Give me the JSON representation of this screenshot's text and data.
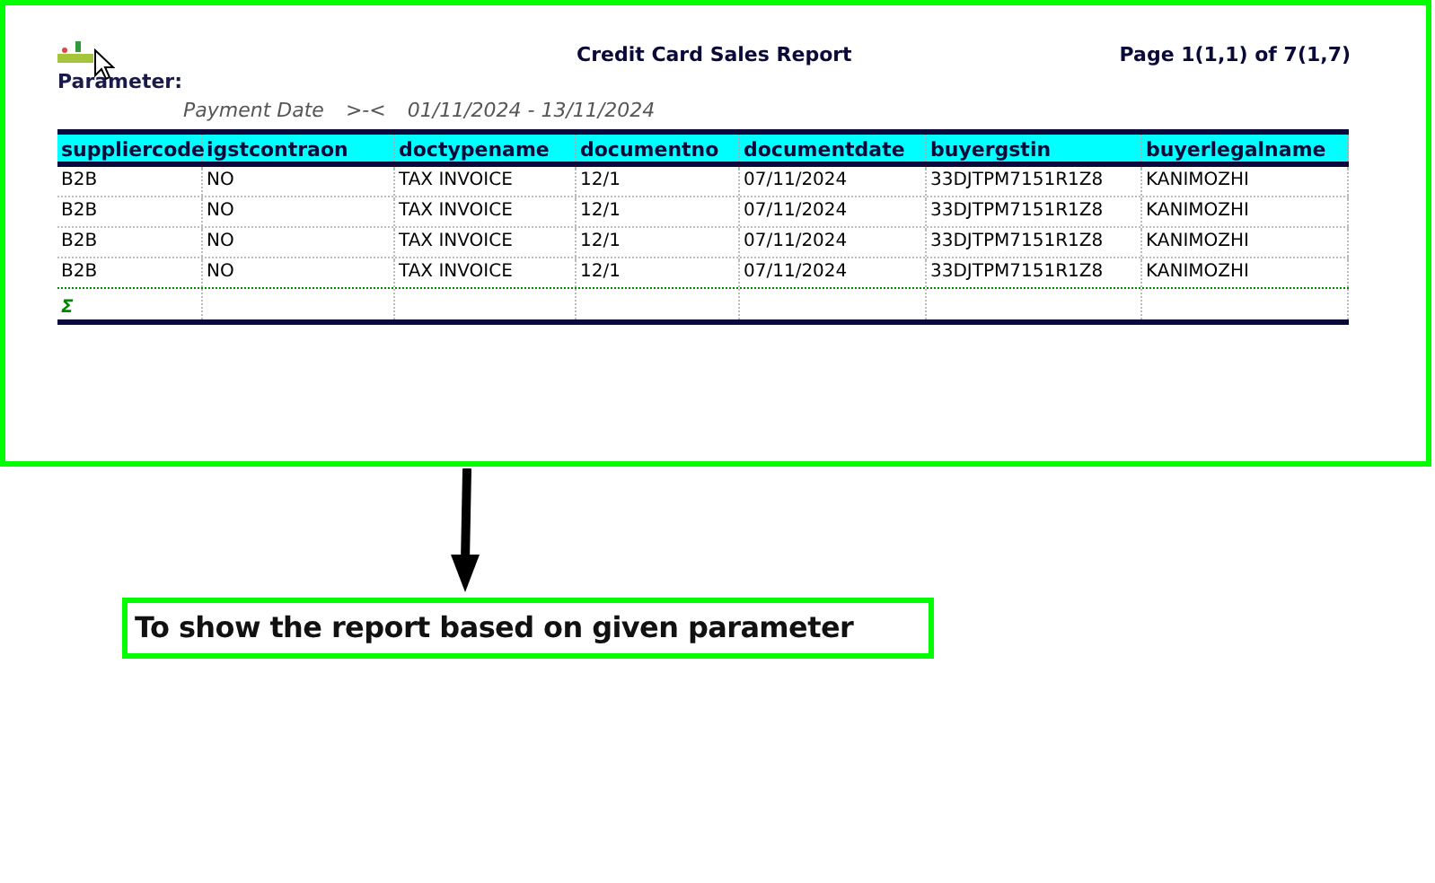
{
  "report": {
    "title": "Credit Card Sales Report",
    "page": "Page 1(1,1) of 7(1,7)",
    "parameter_label": "Parameter:",
    "filter": {
      "field": "Payment Date",
      "operator": ">-<",
      "range": "01/11/2024 - 13/11/2024"
    },
    "table": {
      "columns": [
        "suppliercode",
        "igstcontraon",
        "doctypename",
        "documentno",
        "documentdate",
        "buyergstin",
        "buyerlegalname"
      ],
      "rows": [
        [
          "B2B",
          "NO",
          "TAX INVOICE",
          "12/1",
          "07/11/2024",
          "33DJTPM7151R1Z8",
          "KANIMOZHI"
        ],
        [
          "B2B",
          "NO",
          "TAX INVOICE",
          "12/1",
          "07/11/2024",
          "33DJTPM7151R1Z8",
          "KANIMOZHI"
        ],
        [
          "B2B",
          "NO",
          "TAX INVOICE",
          "12/1",
          "07/11/2024",
          "33DJTPM7151R1Z8",
          "KANIMOZHI"
        ],
        [
          "B2B",
          "NO",
          "TAX INVOICE",
          "12/1",
          "07/11/2024",
          "33DJTPM7151R1Z8",
          "KANIMOZHI"
        ]
      ],
      "total_symbol": "Σ"
    }
  },
  "caption": "To show the report based on given parameter"
}
